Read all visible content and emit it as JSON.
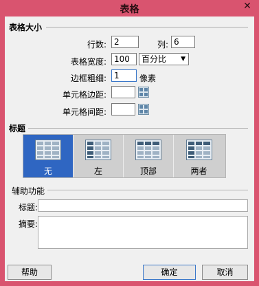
{
  "window": {
    "title": "表格",
    "close_glyph": "✕"
  },
  "table_size": {
    "section_label": "表格大小",
    "rows_label": "行数:",
    "rows_value": "2",
    "cols_label": "列:",
    "cols_value": "6",
    "width_label": "表格宽度:",
    "width_value": "100",
    "width_unit": "百分比",
    "border_label": "边框粗细:",
    "border_value": "1",
    "border_unit": "像素",
    "padding_label": "单元格边距:",
    "padding_value": "",
    "spacing_label": "单元格间距:",
    "spacing_value": ""
  },
  "header": {
    "section_label": "标题",
    "options": [
      {
        "label": "无",
        "icon": "table-header-none-icon",
        "selected": true
      },
      {
        "label": "左",
        "icon": "table-header-left-icon",
        "selected": false
      },
      {
        "label": "顶部",
        "icon": "table-header-top-icon",
        "selected": false
      },
      {
        "label": "两者",
        "icon": "table-header-both-icon",
        "selected": false
      }
    ]
  },
  "accessibility": {
    "section_label": "辅助功能",
    "caption_label": "标题:",
    "caption_value": "",
    "summary_label": "摘要:",
    "summary_value": ""
  },
  "buttons": {
    "help": "帮助",
    "ok": "确定",
    "cancel": "取消"
  },
  "colors": {
    "titlebar": "#d9546f",
    "selected_tile": "#2f66c2",
    "dialog_bg": "#f0f0f0"
  }
}
